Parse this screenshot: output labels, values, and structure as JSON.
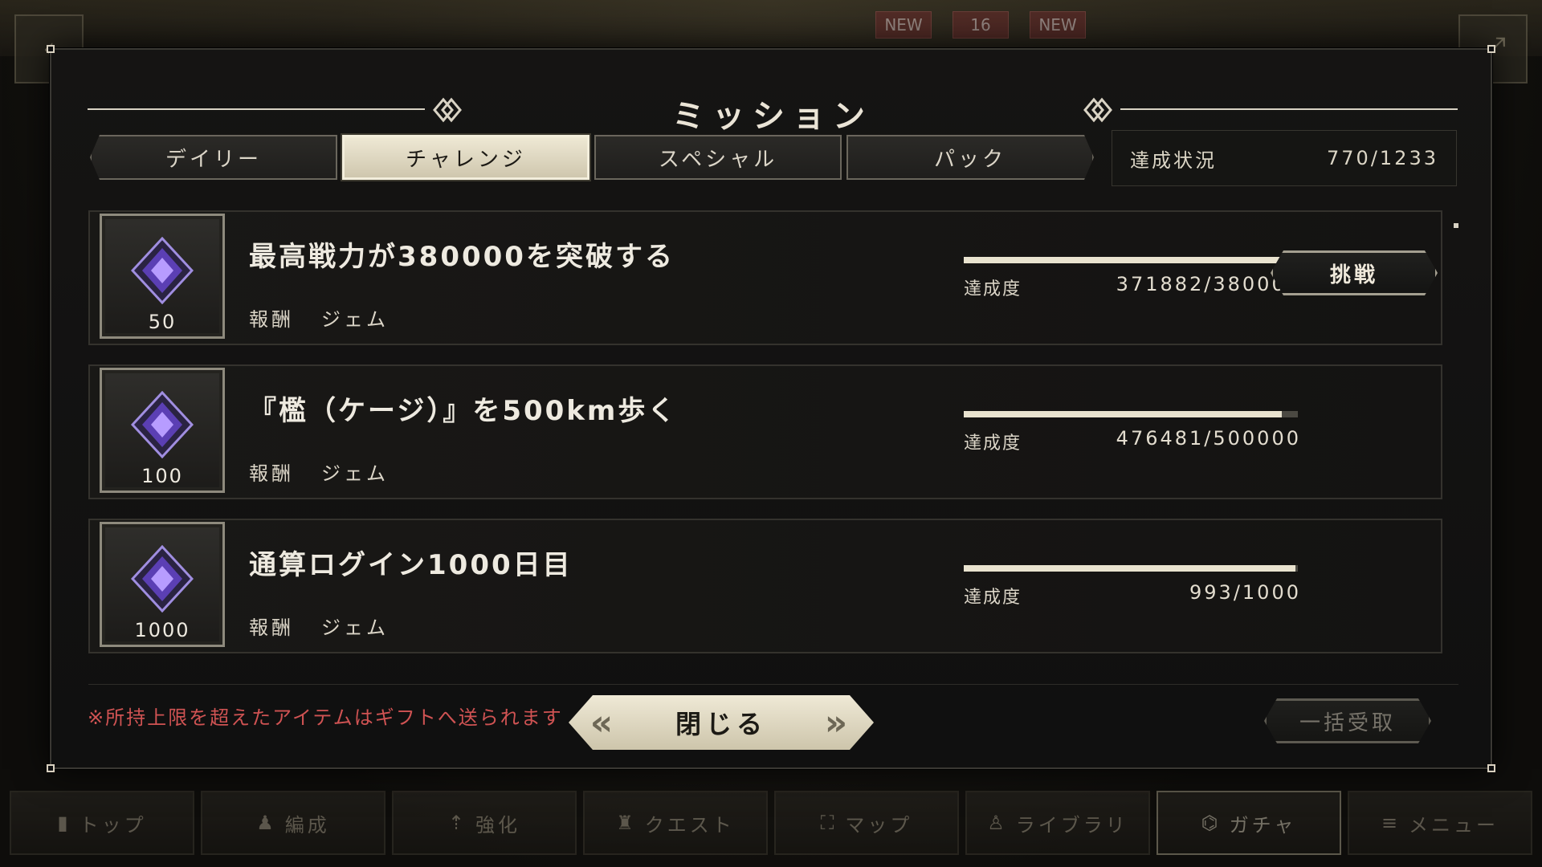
{
  "background": {
    "badges": [
      "NEW",
      "16",
      "NEW"
    ],
    "bottom_nav": [
      {
        "label": "トップ",
        "icon": "home-icon"
      },
      {
        "label": "編成",
        "icon": "formation-icon"
      },
      {
        "label": "強化",
        "icon": "upgrade-icon"
      },
      {
        "label": "クエスト",
        "icon": "quest-icon"
      },
      {
        "label": "マップ",
        "icon": "map-icon"
      },
      {
        "label": "ライブラリ",
        "icon": "library-icon"
      },
      {
        "label": "ガチャ",
        "icon": "gacha-icon"
      },
      {
        "label": "メニュー",
        "icon": "menu-icon"
      }
    ]
  },
  "modal": {
    "title": "ミッション",
    "tabs": [
      {
        "label": "デイリー",
        "active": false
      },
      {
        "label": "チャレンジ",
        "active": true
      },
      {
        "label": "スペシャル",
        "active": false
      },
      {
        "label": "パック",
        "active": false
      }
    ],
    "summary": {
      "label": "達成状況",
      "value": "770/1233"
    },
    "missions": [
      {
        "title": "最高戦力が380000を突破する",
        "reward_label": "報酬",
        "reward_name": "ジェム",
        "reward_count": "50",
        "progress_label": "達成度",
        "progress_text": "371882/380000",
        "progress_ratio": 0.9786,
        "button_label": "挑戦"
      },
      {
        "title": "『檻（ケージ）』を500km歩く",
        "reward_label": "報酬",
        "reward_name": "ジェム",
        "reward_count": "100",
        "progress_label": "達成度",
        "progress_text": "476481/500000",
        "progress_ratio": 0.953,
        "button_label": ""
      },
      {
        "title": "通算ログイン1000日目",
        "reward_label": "報酬",
        "reward_name": "ジェム",
        "reward_count": "1000",
        "progress_label": "達成度",
        "progress_text": "993/1000",
        "progress_ratio": 0.993,
        "button_label": ""
      }
    ],
    "notice": "※所持上限を超えたアイテムはギフトへ送られます",
    "bulk_receive_label": "一括受取",
    "close_label": "閉じる"
  },
  "colors": {
    "accent": "#e9e3cf",
    "notice": "#d05353",
    "gem": "#7b5bd6"
  }
}
